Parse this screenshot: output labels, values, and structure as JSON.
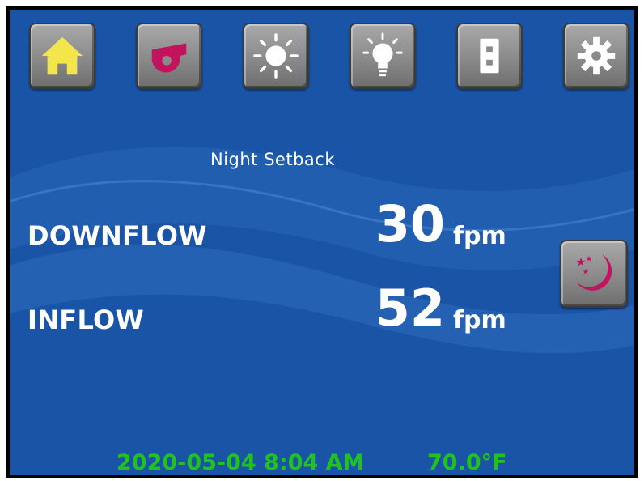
{
  "toolbar": {
    "buttons": [
      {
        "icon": "home-icon",
        "color": "#f2e64a"
      },
      {
        "icon": "blower-icon",
        "color": "#c3135e"
      },
      {
        "icon": "uv-light-icon",
        "color": "#ffffff"
      },
      {
        "icon": "light-bulb-icon",
        "color": "#ffffff"
      },
      {
        "icon": "outlet-icon",
        "color": "#ffffff"
      },
      {
        "icon": "gear-icon",
        "color": "#ffffff"
      }
    ]
  },
  "mode": {
    "label": "Night Setback"
  },
  "readings": {
    "downflow": {
      "label": "DOWNFLOW",
      "value": "30",
      "unit": "fpm"
    },
    "inflow": {
      "label": "INFLOW",
      "value": "52",
      "unit": "fpm"
    }
  },
  "night_button": {
    "icon": "moon-stars-icon",
    "color": "#c3135e"
  },
  "status_bar": {
    "datetime": "2020-05-04 8:04 AM",
    "temperature": "70.0°F",
    "color": "#1fc21f"
  },
  "theme": {
    "background": "#1a54a6"
  }
}
